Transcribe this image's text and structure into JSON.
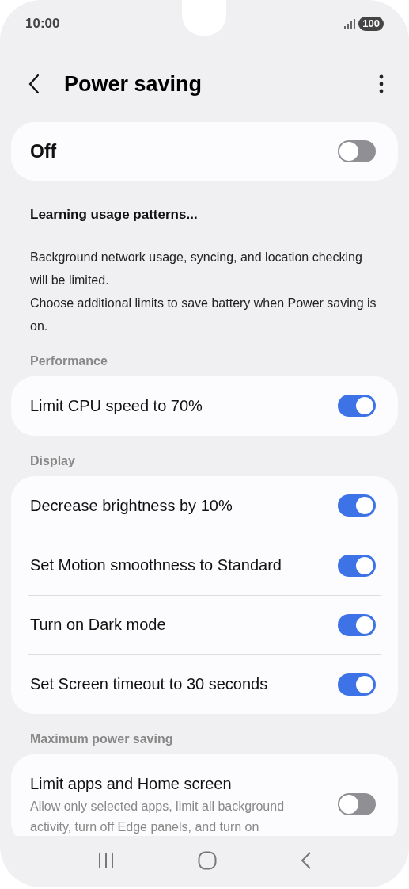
{
  "status_bar": {
    "time": "10:00",
    "battery": "100"
  },
  "header": {
    "title": "Power saving"
  },
  "master": {
    "label": "Off",
    "on": false
  },
  "info": {
    "title": "Learning usage patterns...",
    "lines": [
      "Background network usage, syncing, and location checking will be limited.",
      "Choose additional limits to save battery when Power saving is on."
    ]
  },
  "sections": [
    {
      "title": "Performance",
      "items": [
        {
          "label": "Limit CPU speed to 70%",
          "on": true
        }
      ]
    },
    {
      "title": "Display",
      "items": [
        {
          "label": "Decrease brightness by 10%",
          "on": true
        },
        {
          "label": "Set Motion smoothness to Standard",
          "on": true
        },
        {
          "label": "Turn on Dark mode",
          "on": true
        },
        {
          "label": "Set Screen timeout to 30 seconds",
          "on": true
        }
      ]
    },
    {
      "title": "Maximum power saving",
      "items": [
        {
          "label": "Limit apps and Home screen",
          "description": "Allow only selected apps, limit all background activity, turn off Edge panels, and turn on",
          "on": false
        }
      ]
    }
  ]
}
